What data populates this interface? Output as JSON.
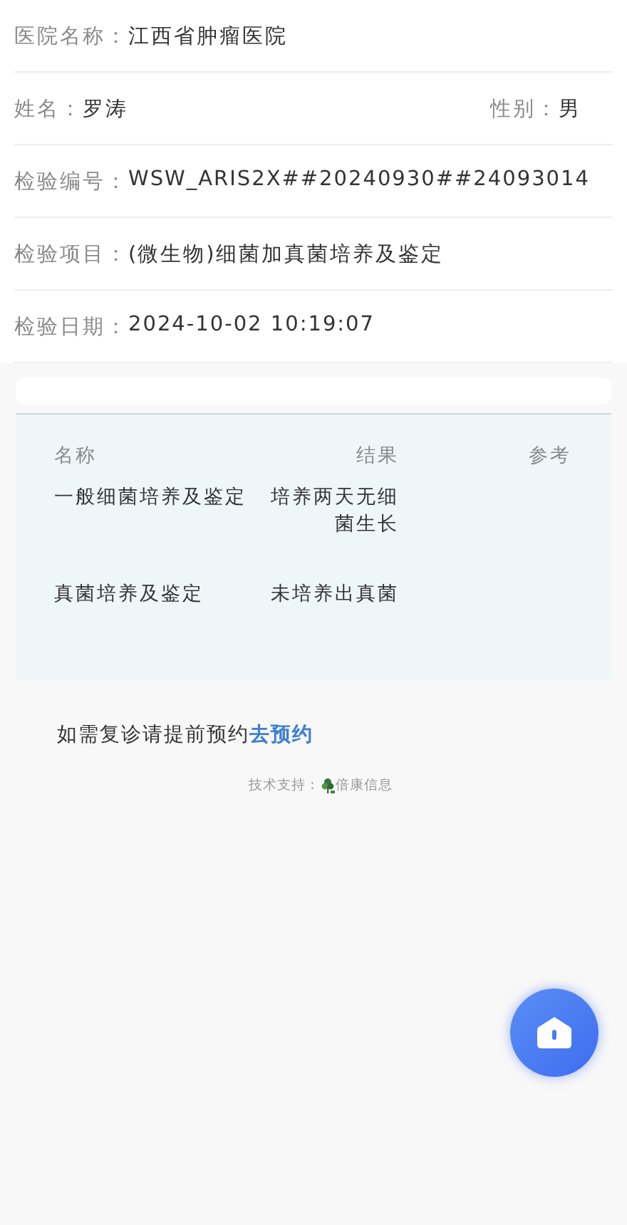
{
  "info_rows": [
    {
      "fields": [
        {
          "label": "医院名称：",
          "value": "江西省肿瘤医院"
        }
      ]
    },
    {
      "fields": [
        {
          "label": "姓名：",
          "value": "罗涛"
        },
        {
          "label": "性别：",
          "value": "男"
        }
      ]
    },
    {
      "fields": [
        {
          "label": "检验编号：",
          "value": "WSW_ARIS2X##20240930##24093014"
        }
      ]
    },
    {
      "fields": [
        {
          "label": "检验项目：",
          "value": "(微生物)细菌加真菌培养及鉴定"
        }
      ]
    },
    {
      "fields": [
        {
          "label": "检验日期：",
          "value": "2024-10-02 10:19:07"
        }
      ]
    }
  ],
  "results": {
    "columns": [
      "名称",
      "结果",
      "参考"
    ],
    "rows": [
      {
        "name": "一般细菌培养及鉴定",
        "result": "培养两天无细菌生长"
      },
      {
        "name": "真菌培养及鉴定",
        "result": "未培养出真菌"
      }
    ]
  },
  "note": {
    "text": "如需复诊请提前预约",
    "link": "去预约"
  },
  "support": {
    "label": "技术支持：",
    "company": "倍康信息"
  }
}
